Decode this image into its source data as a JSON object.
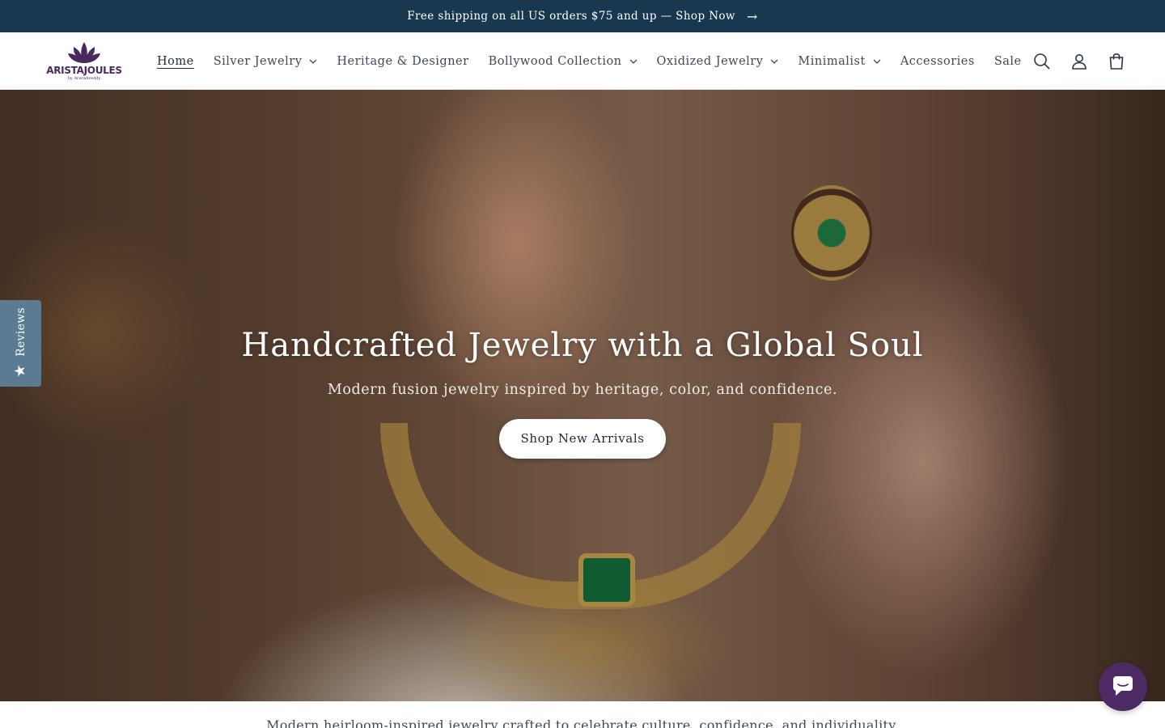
{
  "announcement": {
    "text": "Free shipping on all US orders $75 and up — Shop Now",
    "arrow": "→"
  },
  "logo": {
    "brand": "ARISTAJOULES",
    "tagline": "by Aristahreddy",
    "accent": "#4a2a5e"
  },
  "nav": {
    "items": [
      {
        "label": "Home",
        "active": true,
        "has_dropdown": false
      },
      {
        "label": "Silver Jewelry",
        "has_dropdown": true
      },
      {
        "label": "Heritage & Designer",
        "has_dropdown": false
      },
      {
        "label": "Bollywood Collection",
        "has_dropdown": true
      },
      {
        "label": "Oxidized Jewelry",
        "has_dropdown": true
      },
      {
        "label": "Minimalist",
        "has_dropdown": true
      },
      {
        "label": "Accessories",
        "has_dropdown": false
      },
      {
        "label": "Sale",
        "has_dropdown": false
      }
    ]
  },
  "header_icons": [
    "search-icon",
    "account-icon",
    "cart-icon"
  ],
  "hero": {
    "title": "Handcrafted Jewelry with a Global Soul",
    "subtitle": "Modern fusion jewelry inspired by heritage, color, and confidence.",
    "cta_label": "Shop New Arrivals"
  },
  "reviews_tab": {
    "label": "Reviews",
    "icon": "star-icon",
    "color": "#5b7b93"
  },
  "chat": {
    "icon": "chat-icon",
    "color": "#4d2a63"
  },
  "intro_text": "Modern heirloom-inspired jewelry crafted to celebrate culture, confidence, and individuality.",
  "colors": {
    "announcement_bg": "#17384f",
    "text": "#3d4a55"
  }
}
